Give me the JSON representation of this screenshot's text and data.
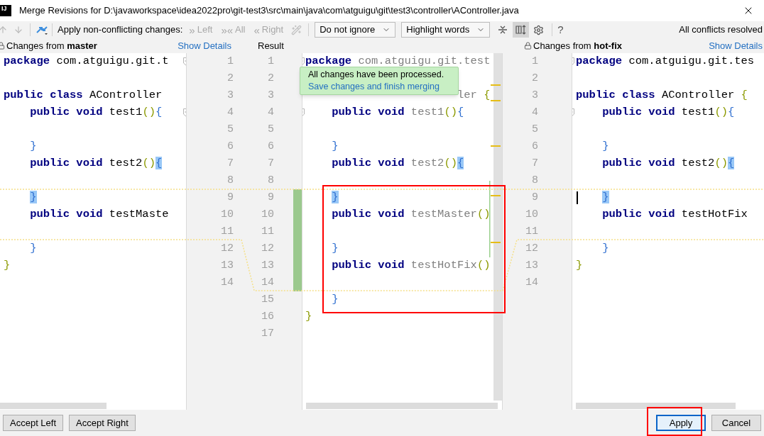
{
  "window": {
    "logo": "IJ",
    "title": "Merge Revisions for D:\\javaworkspace\\idea2022pro\\git-test3\\src\\main\\java\\com\\atguigu\\git\\test3\\controller\\AController.java"
  },
  "toolbar": {
    "prev_disabled": true,
    "next_disabled": true,
    "apply_label": "Apply non-conflicting changes:",
    "apply_buttons": [
      {
        "glyph": "»",
        "label": "Left",
        "disabled": true
      },
      {
        "glyph": "»«",
        "label": "All",
        "disabled": true
      },
      {
        "glyph": "«",
        "label": "Right",
        "disabled": true
      }
    ],
    "wand_disabled": true,
    "dropdowns": [
      {
        "value": "Do not ignore"
      },
      {
        "value": "Highlight words"
      }
    ],
    "side_by_side": {
      "selected": true
    },
    "help": "?",
    "status": "All conflicts resolved"
  },
  "headers": {
    "left": {
      "label": "Changes from **master**",
      "locked": true,
      "link": "Show Details"
    },
    "result": "Result",
    "right": {
      "label": "Changes from **hot-fix**",
      "locked": true,
      "link": "Show Details"
    }
  },
  "left": [
    {
      "number": "1",
      "foldable": true,
      "tokens": [
        {
          "kind": "keyword",
          "text": "package"
        },
        {
          "kind": "name",
          "text": "com.atguigu.git.t"
        }
      ]
    },
    {
      "number": "2"
    },
    {
      "number": "3",
      "tokens": [
        {
          "kind": "keyword",
          "text": "public"
        },
        {
          "kind": "keyword",
          "text": "class"
        },
        {
          "kind": "name",
          "text": "AController"
        }
      ]
    },
    {
      "number": "4",
      "indented": true,
      "foldable": true,
      "tokens": [
        {
          "kind": "keyword",
          "text": "public"
        },
        {
          "kind": "keyword",
          "text": "void"
        },
        {
          "kind": "name",
          "text": "test1"
        },
        {
          "kind": "paren",
          "text": "()"
        },
        {
          "kind": "brace",
          "text": "{"
        }
      ]
    },
    {
      "number": "5"
    },
    {
      "number": "6",
      "indented": true,
      "tokens": [
        {
          "kind": "brace",
          "text": "}"
        }
      ]
    },
    {
      "number": "7",
      "indented": true,
      "tokens": [
        {
          "kind": "keyword",
          "text": "public"
        },
        {
          "kind": "keyword",
          "text": "void"
        },
        {
          "kind": "name",
          "text": "test2"
        },
        {
          "kind": "paren",
          "text": "()"
        },
        {
          "kind": "brace-match",
          "text": "{"
        }
      ]
    },
    {
      "number": "8"
    },
    {
      "number": "9",
      "indented": true,
      "tokens": [
        {
          "kind": "brace-match",
          "text": "}"
        }
      ]
    },
    {
      "number": "10",
      "indented": true,
      "tokens": [
        {
          "kind": "keyword",
          "text": "public"
        },
        {
          "kind": "keyword",
          "text": "void"
        },
        {
          "kind": "name",
          "text": "testMaste"
        }
      ]
    },
    {
      "number": "11"
    },
    {
      "number": "12",
      "indented": true,
      "tokens": [
        {
          "kind": "brace",
          "text": "}"
        }
      ]
    },
    {
      "number": "13",
      "tokens": [
        {
          "kind": "brace-outer",
          "text": "}"
        }
      ]
    },
    {
      "number": "14"
    }
  ],
  "result": [
    {
      "number": "1",
      "foldable": true,
      "tokens": [
        {
          "kind": "keyword",
          "text": "package"
        },
        {
          "kind": "name-result",
          "text": "com.atguigu.git.test"
        }
      ]
    },
    {
      "number": "2"
    },
    {
      "number": "3",
      "partly_hidden": true,
      "tokens": [
        {
          "kind": "name-result",
          "text": "ler"
        },
        {
          "kind": "brace-outer",
          "text": "{"
        }
      ]
    },
    {
      "number": "4",
      "indented": true,
      "foldable": true,
      "tokens": [
        {
          "kind": "keyword",
          "text": "public"
        },
        {
          "kind": "keyword",
          "text": "void"
        },
        {
          "kind": "name-result",
          "text": "test1"
        },
        {
          "kind": "paren",
          "text": "()"
        },
        {
          "kind": "brace",
          "text": "{"
        }
      ]
    },
    {
      "number": "5"
    },
    {
      "number": "6",
      "indented": true,
      "tokens": [
        {
          "kind": "brace",
          "text": "}"
        }
      ]
    },
    {
      "number": "7",
      "indented": true,
      "tokens": [
        {
          "kind": "keyword",
          "text": "public"
        },
        {
          "kind": "keyword",
          "text": "void"
        },
        {
          "kind": "name-result",
          "text": "test2"
        },
        {
          "kind": "paren",
          "text": "()"
        },
        {
          "kind": "brace-match",
          "text": "{"
        }
      ]
    },
    {
      "number": "8"
    },
    {
      "number": "9",
      "indented": true,
      "changed": true,
      "tokens": [
        {
          "kind": "brace-match",
          "text": "}"
        }
      ]
    },
    {
      "number": "10",
      "indented": true,
      "changed": true,
      "tokens": [
        {
          "kind": "keyword",
          "text": "public"
        },
        {
          "kind": "keyword",
          "text": "void"
        },
        {
          "kind": "name-result",
          "text": "testMaster"
        },
        {
          "kind": "paren",
          "text": "()"
        }
      ]
    },
    {
      "number": "11",
      "changed": true
    },
    {
      "number": "12",
      "indented": true,
      "changed": true,
      "tokens": [
        {
          "kind": "brace",
          "text": "}"
        }
      ]
    },
    {
      "number": "13",
      "indented": true,
      "changed": true,
      "tokens": [
        {
          "kind": "keyword",
          "text": "public"
        },
        {
          "kind": "keyword",
          "text": "void"
        },
        {
          "kind": "name-result",
          "text": "testHotFix"
        },
        {
          "kind": "paren",
          "text": "()"
        }
      ]
    },
    {
      "number": "14",
      "changed": true
    },
    {
      "number": "15",
      "indented": true,
      "tokens": [
        {
          "kind": "brace",
          "text": "}"
        }
      ]
    },
    {
      "number": "16",
      "tokens": [
        {
          "kind": "brace-outer",
          "text": "}"
        }
      ]
    },
    {
      "number": "17"
    }
  ],
  "right": [
    {
      "number": "1",
      "foldable": true,
      "tokens": [
        {
          "kind": "keyword",
          "text": "package"
        },
        {
          "kind": "name",
          "text": "com.atguigu.git.tes"
        }
      ]
    },
    {
      "number": "2"
    },
    {
      "number": "3",
      "tokens": [
        {
          "kind": "keyword",
          "text": "public"
        },
        {
          "kind": "keyword",
          "text": "class"
        },
        {
          "kind": "name",
          "text": "AController"
        },
        {
          "kind": "brace-outer",
          "text": "{"
        }
      ]
    },
    {
      "number": "4",
      "indented": true,
      "foldable": true,
      "tokens": [
        {
          "kind": "keyword",
          "text": "public"
        },
        {
          "kind": "keyword",
          "text": "void"
        },
        {
          "kind": "name",
          "text": "test1"
        },
        {
          "kind": "paren",
          "text": "()"
        },
        {
          "kind": "brace",
          "text": "{"
        }
      ]
    },
    {
      "number": "5"
    },
    {
      "number": "6",
      "indented": true,
      "tokens": [
        {
          "kind": "brace",
          "text": "}"
        }
      ]
    },
    {
      "number": "7",
      "indented": true,
      "tokens": [
        {
          "kind": "keyword",
          "text": "public"
        },
        {
          "kind": "keyword",
          "text": "void"
        },
        {
          "kind": "name",
          "text": "test2"
        },
        {
          "kind": "paren",
          "text": "()"
        },
        {
          "kind": "brace-match",
          "text": "{"
        }
      ]
    },
    {
      "number": "8"
    },
    {
      "number": "9",
      "indented": true,
      "caret": true,
      "tokens": [
        {
          "kind": "brace-match",
          "text": "}"
        }
      ]
    },
    {
      "number": "10",
      "indented": true,
      "tokens": [
        {
          "kind": "keyword",
          "text": "public"
        },
        {
          "kind": "keyword",
          "text": "void"
        },
        {
          "kind": "name",
          "text": "testHotFix"
        }
      ]
    },
    {
      "number": "11"
    },
    {
      "number": "12",
      "indented": true,
      "tokens": [
        {
          "kind": "brace",
          "text": "}"
        }
      ]
    },
    {
      "number": "13",
      "tokens": [
        {
          "kind": "brace-outer",
          "text": "}"
        }
      ]
    },
    {
      "number": "14"
    }
  ],
  "tooltip": {
    "message": "All changes have been processed.",
    "link": "Save changes and finish merging"
  },
  "footer": {
    "left_buttons": [
      "Accept Left",
      "Accept Right"
    ],
    "right_buttons": [
      {
        "label": "Apply",
        "default": true,
        "framed": true
      },
      {
        "label": "Cancel",
        "default": false
      }
    ]
  },
  "result_framed": true
}
